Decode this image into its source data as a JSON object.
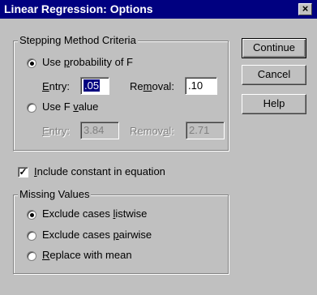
{
  "window": {
    "title": "Linear Regression: Options",
    "close_label": "×"
  },
  "stepping": {
    "legend": "Stepping Method Criteria",
    "use_probability": {
      "label_pre": "Use ",
      "label_u": "p",
      "label_post": "robability of F",
      "selected": true
    },
    "prob_entry": {
      "label_u": "E",
      "label_post": "ntry:",
      "value": ".05"
    },
    "prob_removal": {
      "label_pre": "Re",
      "label_u": "m",
      "label_post": "oval:",
      "value": ".10"
    },
    "use_f_value": {
      "label_pre": "Use F ",
      "label_u": "v",
      "label_post": "alue",
      "selected": false
    },
    "f_entry": {
      "label_u": "E",
      "label_post": "ntry:",
      "value": "3.84"
    },
    "f_removal": {
      "label_pre": "Remov",
      "label_u": "a",
      "label_post": "l:",
      "value": "2.71"
    }
  },
  "include_constant": {
    "label_u": "I",
    "label_post": "nclude constant in equation",
    "checked": true
  },
  "missing": {
    "legend": "Missing Values",
    "listwise": {
      "label_pre": "Exclude cases ",
      "label_u": "l",
      "label_post": "istwise",
      "selected": true
    },
    "pairwise": {
      "label_pre": "Exclude cases ",
      "label_u": "p",
      "label_post": "airwise",
      "selected": false
    },
    "replace": {
      "label_u": "R",
      "label_post": "eplace with mean",
      "selected": false
    }
  },
  "buttons": {
    "continue": "Continue",
    "cancel": "Cancel",
    "help": "Help"
  }
}
